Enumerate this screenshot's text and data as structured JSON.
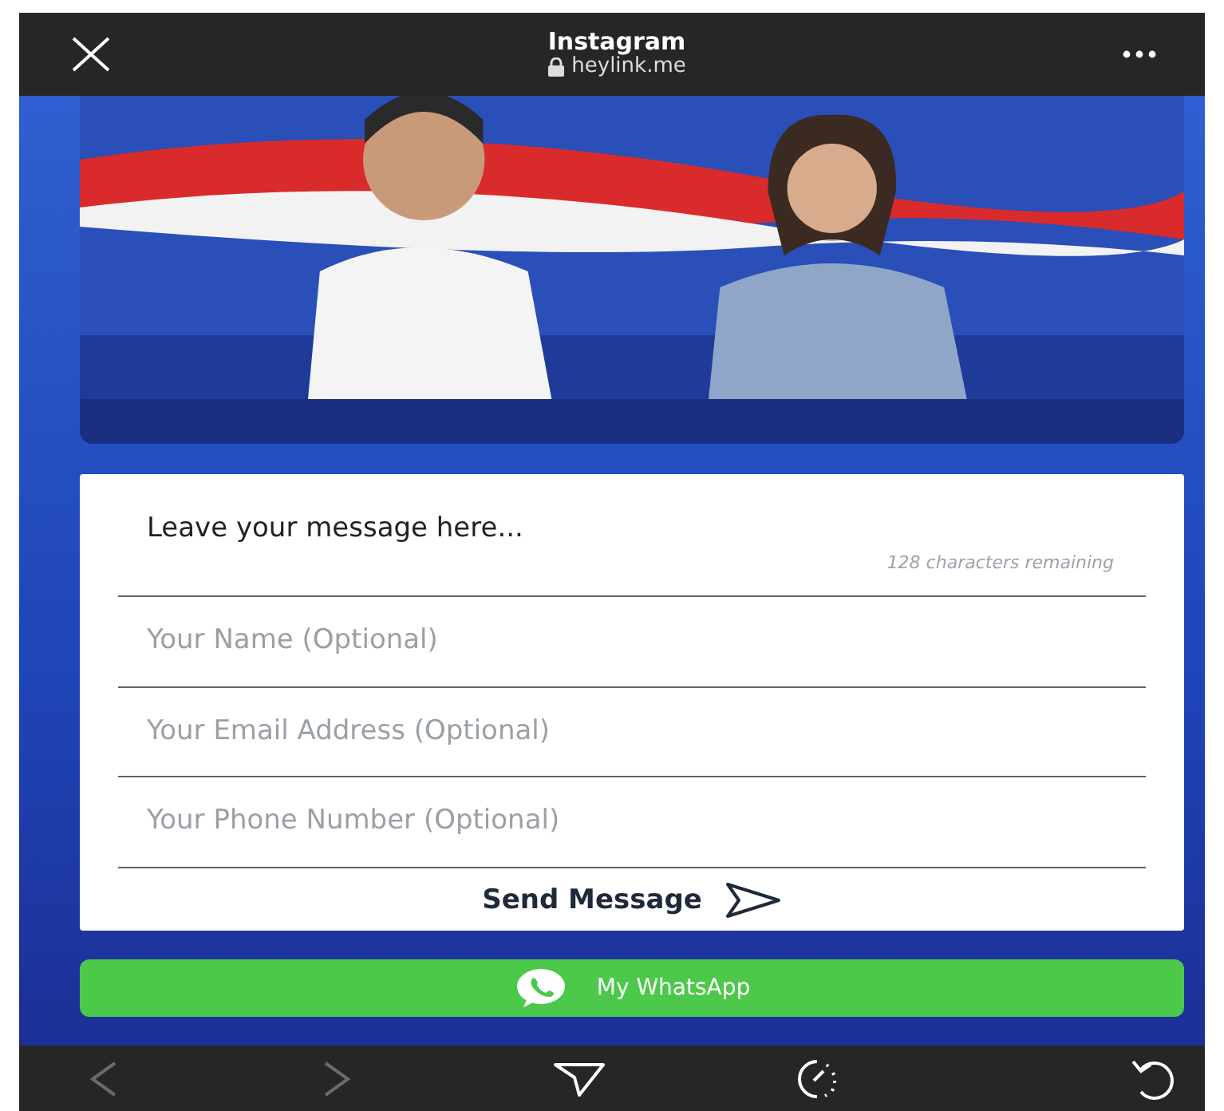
{
  "top_bar": {
    "title": "Instagram",
    "url": "heylink.me"
  },
  "form": {
    "message": {
      "placeholder": "Leave your message here...",
      "counter": "128 characters remaining"
    },
    "fields": [
      {
        "placeholder": "Your Name (Optional)"
      },
      {
        "placeholder": "Your Email Address (Optional)"
      },
      {
        "placeholder": "Your Phone Number (Optional)"
      }
    ],
    "submit": "Send Message"
  },
  "link_button": {
    "label": "My WhatsApp"
  },
  "bottom_bar": {
    "back": {
      "disabled": true
    },
    "forward": {
      "disabled": true
    }
  }
}
